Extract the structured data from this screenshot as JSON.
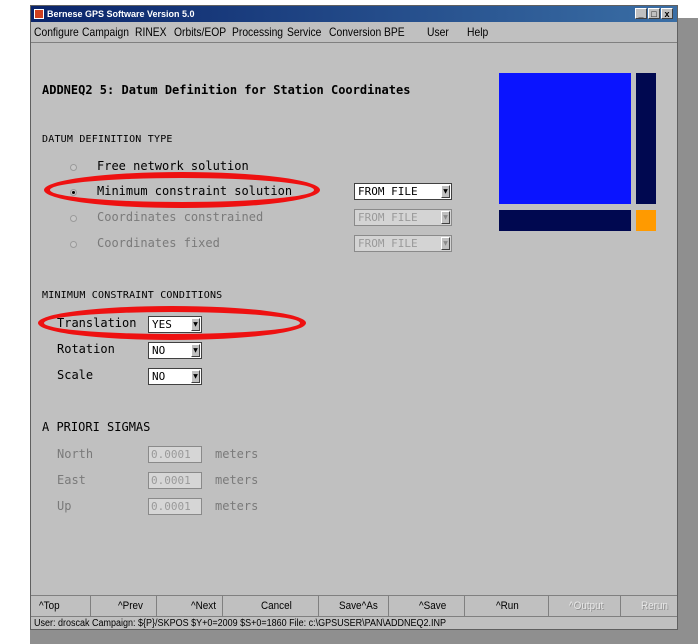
{
  "window": {
    "title": "Bernese GPS Software Version 5.0",
    "controls": [
      "_",
      "□",
      "x"
    ]
  },
  "menu": [
    "Configure",
    "Campaign",
    "RINEX",
    "Orbits/EOP",
    "Processing",
    "Service",
    "Conversion",
    "BPE",
    "User",
    "Help"
  ],
  "panel": {
    "heading": "ADDNEQ2 5: Datum Definition for Station Coordinates",
    "datum_section": "DATUM DEFINITION TYPE",
    "datum_options": [
      {
        "label": "Free network solution",
        "selected": false
      },
      {
        "label": "Minimum constraint solution",
        "selected": true,
        "source": "FROM FILE"
      },
      {
        "label": "Coordinates constrained",
        "selected": false,
        "source": "FROM FILE"
      },
      {
        "label": "Coordinates fixed",
        "selected": false,
        "source": "FROM FILE"
      }
    ],
    "conditions_section": "MINIMUM CONSTRAINT CONDITIONS",
    "conditions": [
      {
        "label": "Translation",
        "value": "YES"
      },
      {
        "label": "Rotation",
        "value": "NO"
      },
      {
        "label": "Scale",
        "value": "NO"
      }
    ],
    "sigmas_section": "A PRIORI SIGMAS",
    "sigmas": [
      {
        "label": "North",
        "value": "0.0001",
        "unit": "meters"
      },
      {
        "label": "East",
        "value": "0.0001",
        "unit": "meters"
      },
      {
        "label": "Up",
        "value": "0.0001",
        "unit": "meters"
      }
    ]
  },
  "logo_colors": {
    "primary": "#0a14ff",
    "dark": "#000850",
    "accent": "#ff9a00"
  },
  "highlight_color": "#ee1111",
  "toolbar": [
    "^Top",
    "^Prev",
    "^Next",
    "Cancel",
    "Save^As",
    "^Save",
    "^Run",
    "^Output",
    "Rerun"
  ],
  "status": "User: droscak Campaign: ${P}/SKPOS  $Y+0=2009 $S+0=1860  File: c:\\GPSUSER\\PAN\\ADDNEQ2.INP"
}
